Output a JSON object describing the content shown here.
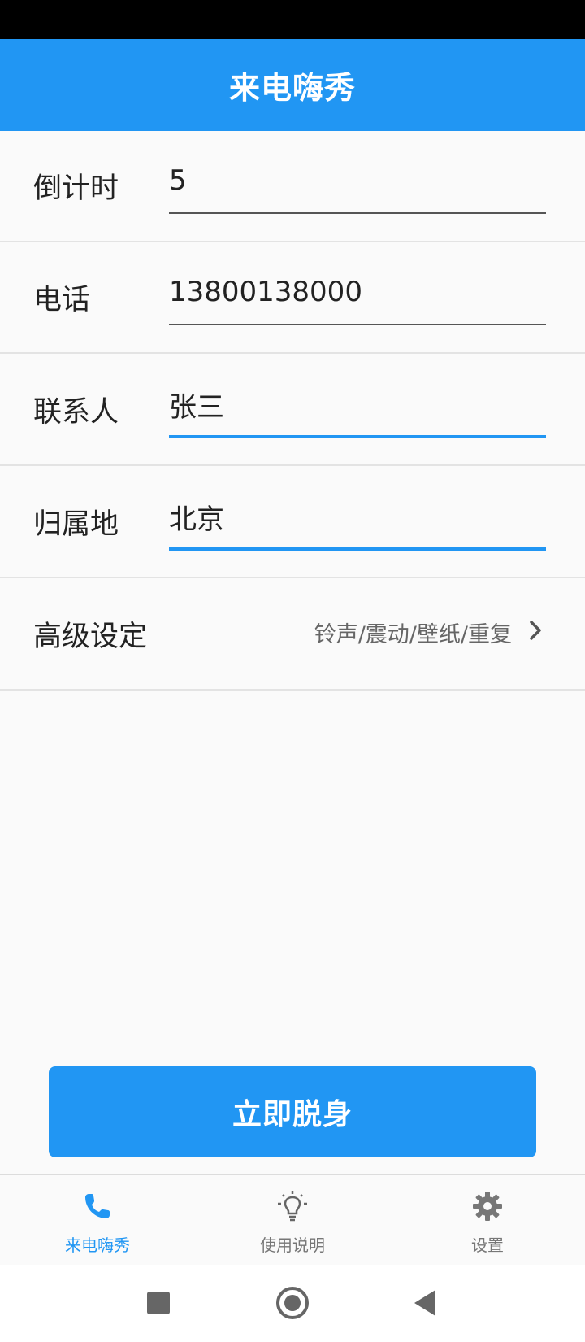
{
  "app": {
    "title": "来电嗨秀",
    "accent_color": "#2196f3"
  },
  "form": {
    "countdown": {
      "label": "倒计时",
      "value": "5"
    },
    "phone": {
      "label": "电话",
      "value": "13800138000"
    },
    "contact": {
      "label": "联系人",
      "value": "张三"
    },
    "location": {
      "label": "归属地",
      "value": "北京"
    },
    "advanced": {
      "label": "高级设定",
      "value": "铃声/震动/壁纸/重复"
    }
  },
  "actions": {
    "escape_label": "立即脱身"
  },
  "bottom_nav": {
    "items": [
      {
        "label": "来电嗨秀",
        "icon": "phone-icon",
        "active": true
      },
      {
        "label": "使用说明",
        "icon": "lightbulb-icon",
        "active": false
      },
      {
        "label": "设置",
        "icon": "gear-icon",
        "active": false
      }
    ]
  },
  "system_nav": {
    "buttons": [
      "recents-square-icon",
      "home-circle-icon",
      "back-triangle-icon"
    ]
  }
}
